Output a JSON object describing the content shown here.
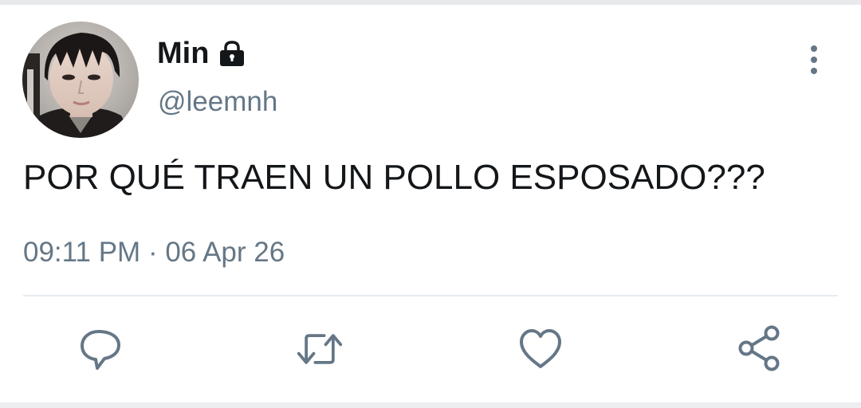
{
  "tweet": {
    "author": {
      "display_name": "Min",
      "handle": "@leemnh",
      "protected_icon": "lock-icon",
      "avatar": "profile-photo"
    },
    "text": "POR QUÉ TRAEN UN POLLO ESPOSADO???",
    "time": "09:11 PM",
    "separator": "·",
    "date": "06 Apr 26"
  },
  "actions": [
    {
      "name": "reply",
      "icon": "speech-bubble-icon"
    },
    {
      "name": "retweet",
      "icon": "retweet-arrows-icon"
    },
    {
      "name": "like",
      "icon": "heart-icon"
    },
    {
      "name": "share",
      "icon": "share-nodes-icon"
    }
  ],
  "menu": {
    "icon": "vertical-dots-icon"
  },
  "colors": {
    "text_primary": "#14171a",
    "text_secondary": "#657786",
    "icon_gray": "#657786",
    "divider": "#e6ecf0",
    "background": "#ffffff"
  }
}
